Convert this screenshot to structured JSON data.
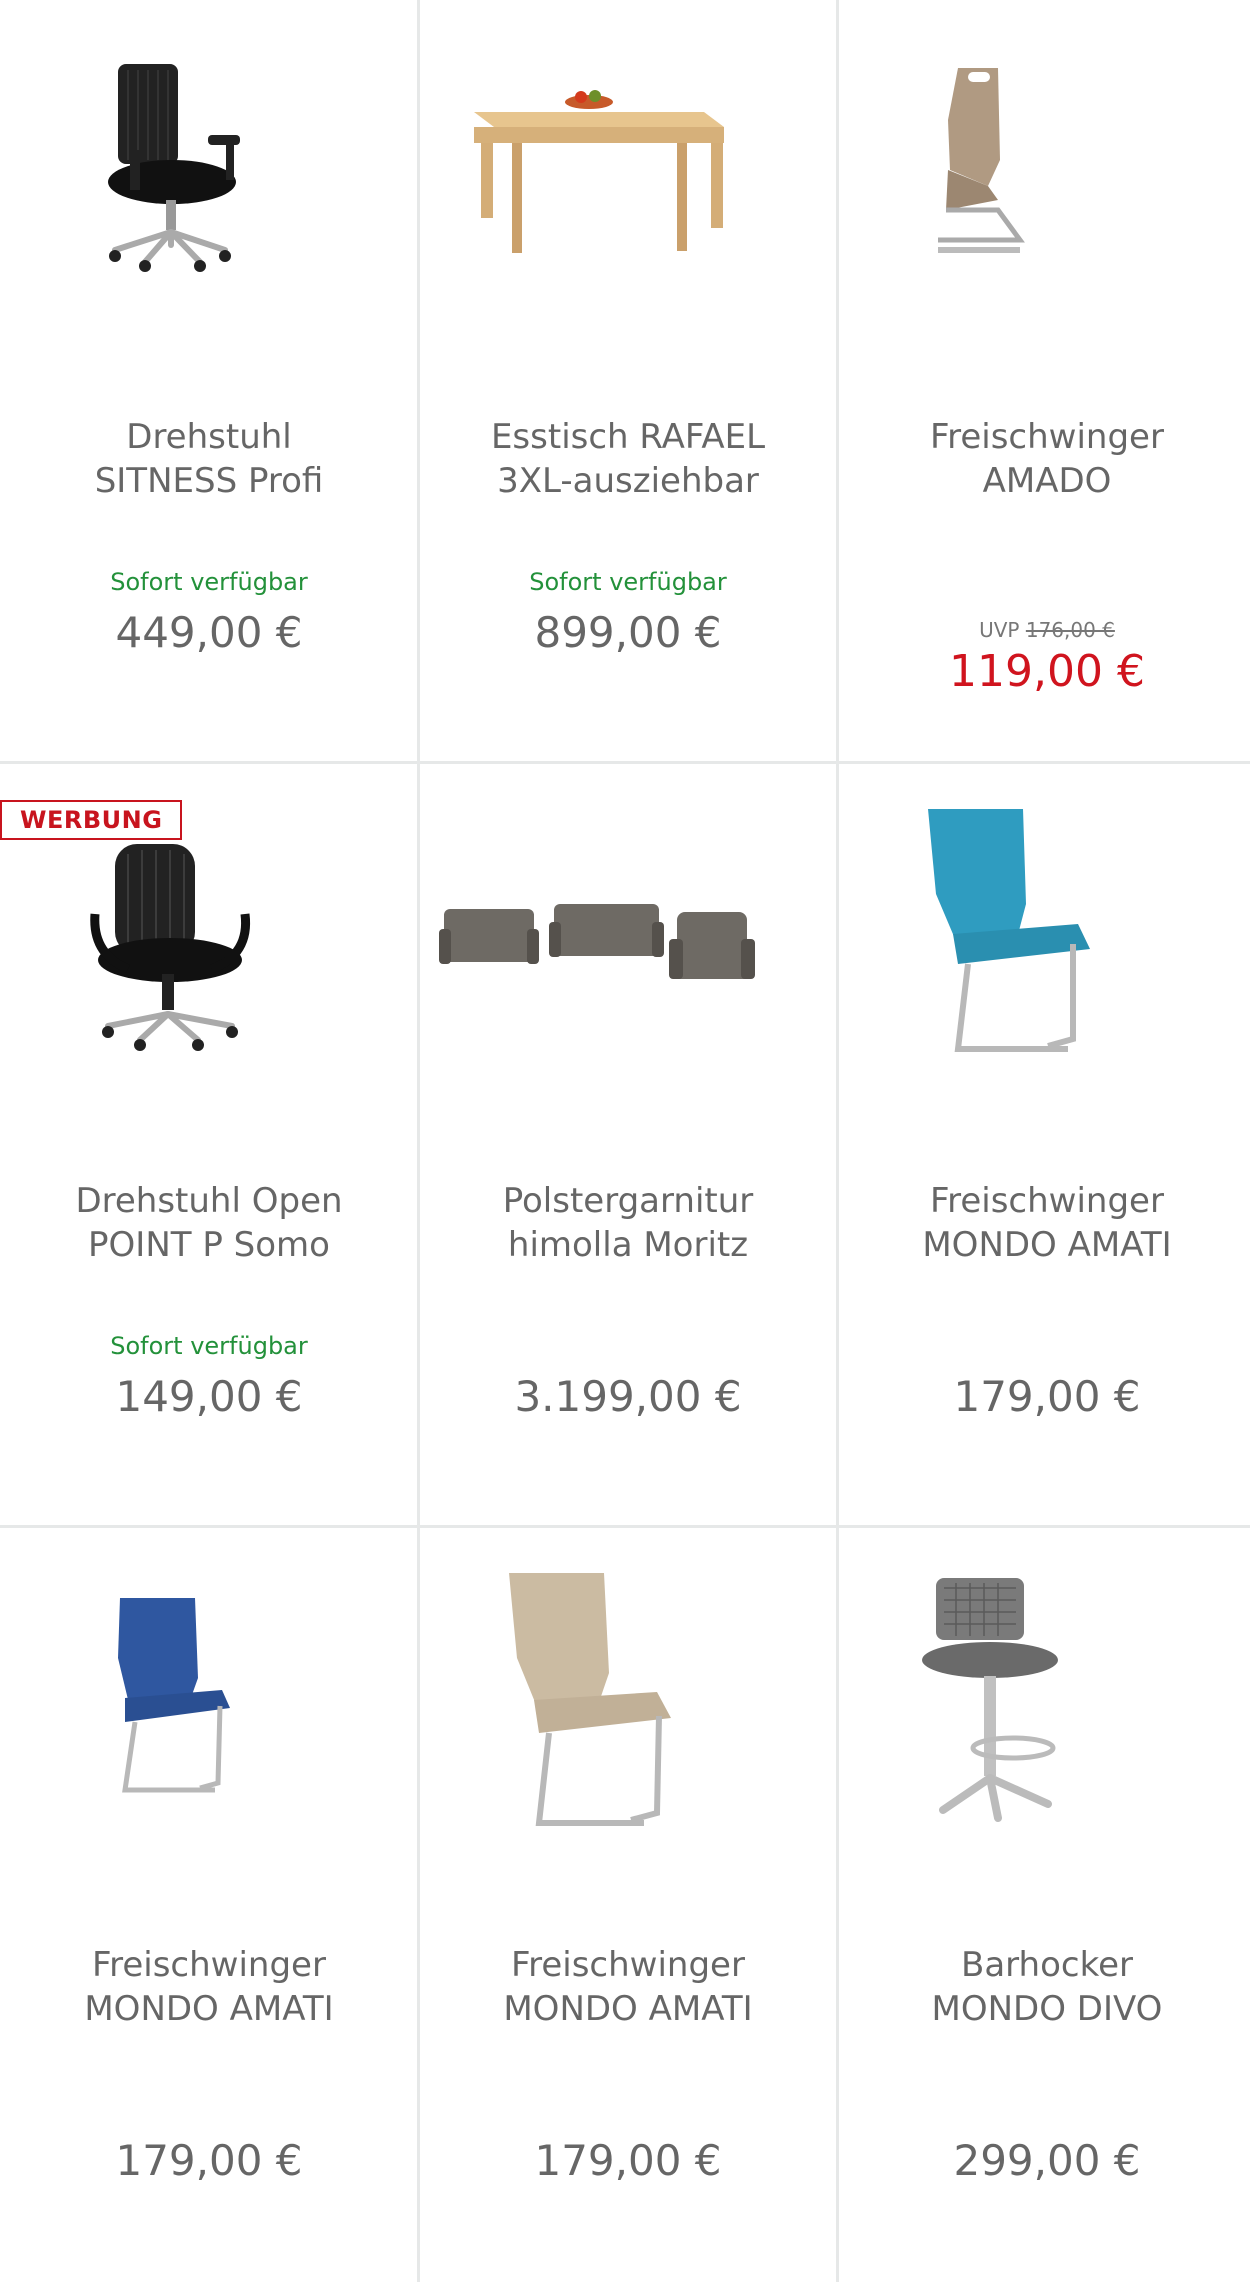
{
  "products": [
    {
      "title_line1": "Drehstuhl",
      "title_line2": "SITNESS Profi",
      "availability": "Sofort verfügbar",
      "price": "449,00 €",
      "image": "office-chair-mesh-icon"
    },
    {
      "title_line1": "Esstisch RAFAEL",
      "title_line2": "3XL-ausziehbar",
      "availability": "Sofort verfügbar",
      "price": "899,00 €",
      "image": "dining-table-icon"
    },
    {
      "title_line1": "Freischwinger",
      "title_line2": "AMADO",
      "uvp_label": "UVP",
      "uvp_price": "176,00 €",
      "sale_price": "119,00 €",
      "image": "cantilever-chair-z-icon"
    },
    {
      "badge": "WERBUNG",
      "title_line1": "Drehstuhl Open",
      "title_line2": "POINT P Somo",
      "availability": "Sofort verfügbar",
      "price": "149,00 €",
      "image": "office-chair-armrests-icon"
    },
    {
      "title_line1": "Polstergarnitur",
      "title_line2": "himolla Moritz",
      "price": "3.199,00 €",
      "image": "sofa-set-icon"
    },
    {
      "title_line1": "Freischwinger",
      "title_line2": "MONDO AMATI",
      "price": "179,00 €",
      "image": "cantilever-chair-teal-icon",
      "color": "#2f9cc0"
    },
    {
      "title_line1": "Freischwinger",
      "title_line2": "MONDO AMATI",
      "price": "179,00 €",
      "image": "cantilever-chair-blue-icon",
      "color": "#2f57a0"
    },
    {
      "title_line1": "Freischwinger",
      "title_line2": "MONDO AMATI",
      "price": "179,00 €",
      "image": "cantilever-chair-beige-icon",
      "color": "#cbbba2"
    },
    {
      "title_line1": "Barhocker",
      "title_line2": "MONDO DIVO",
      "price": "299,00 €",
      "image": "bar-stool-icon"
    }
  ],
  "colors": {
    "availability": "#23913a",
    "sale": "#d0141e",
    "text": "#666666",
    "divider": "#e6e8e8"
  }
}
